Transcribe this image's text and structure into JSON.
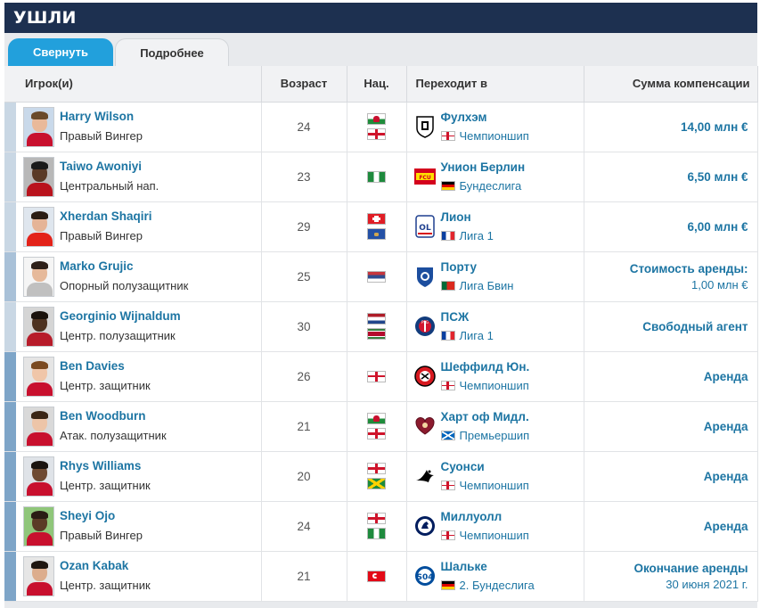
{
  "section_title": "УШЛИ",
  "tabs": {
    "collapse": "Свернуть",
    "details": "Подробнее"
  },
  "columns": {
    "player": "Игрок(и)",
    "age": "Возраст",
    "nationality": "Нац.",
    "to": "Переходит в",
    "fee": "Сумма компенсации"
  },
  "colors": {
    "header_bg": "#1d3050",
    "tab_active": "#22a0dc",
    "link": "#1d75a3"
  },
  "rows": [
    {
      "name": "Harry Wilson",
      "position": "Правый Вингер",
      "age": "24",
      "flags": [
        "wales-flag",
        "england-flag"
      ],
      "club": "Фулхэм",
      "club_icon": "fulham-crest",
      "league_flag": "england-flag",
      "league": "Чемпионшип",
      "fee": "14,00 млн €",
      "fee_note": ""
    },
    {
      "name": "Taiwo Awoniyi",
      "position": "Центральный нап.",
      "age": "23",
      "flags": [
        "nigeria-flag"
      ],
      "club": "Унион Берлин",
      "club_icon": "union-berlin-crest",
      "league_flag": "germany-flag",
      "league": "Бундеслига",
      "fee": "6,50 млн €",
      "fee_note": ""
    },
    {
      "name": "Xherdan Shaqiri",
      "position": "Правый Вингер",
      "age": "29",
      "flags": [
        "switzerland-flag",
        "kosovo-flag"
      ],
      "club": "Лион",
      "club_icon": "lyon-crest",
      "league_flag": "france-flag",
      "league": "Лига 1",
      "fee": "6,00 млн €",
      "fee_note": ""
    },
    {
      "name": "Marko Grujic",
      "position": "Опорный полузащитник",
      "age": "25",
      "flags": [
        "serbia-flag"
      ],
      "club": "Порту",
      "club_icon": "porto-crest",
      "league_flag": "portugal-flag",
      "league": "Лига Бвин",
      "fee": "Стоимость аренды:",
      "fee_note": "1,00 млн €"
    },
    {
      "name": "Georginio Wijnaldum",
      "position": "Центр. полузащитник",
      "age": "30",
      "flags": [
        "netherlands-flag",
        "suriname-flag"
      ],
      "club": "ПСЖ",
      "club_icon": "psg-crest",
      "league_flag": "france-flag",
      "league": "Лига 1",
      "fee": "Свободный агент",
      "fee_note": ""
    },
    {
      "name": "Ben Davies",
      "position": "Центр. защитник",
      "age": "26",
      "flags": [
        "england-flag"
      ],
      "club": "Шеффилд Юн.",
      "club_icon": "sheffield-united-crest",
      "league_flag": "england-flag",
      "league": "Чемпионшип",
      "fee": "Аренда",
      "fee_note": ""
    },
    {
      "name": "Ben Woodburn",
      "position": "Атак. полузащитник",
      "age": "21",
      "flags": [
        "wales-flag",
        "england-flag"
      ],
      "club": "Харт оф Мидл.",
      "club_icon": "hearts-crest",
      "league_flag": "scotland-flag",
      "league": "Премьершип",
      "fee": "Аренда",
      "fee_note": ""
    },
    {
      "name": "Rhys Williams",
      "position": "Центр. защитник",
      "age": "20",
      "flags": [
        "england-flag",
        "jamaica-flag"
      ],
      "club": "Суонси",
      "club_icon": "swansea-crest",
      "league_flag": "england-flag",
      "league": "Чемпионшип",
      "fee": "Аренда",
      "fee_note": ""
    },
    {
      "name": "Sheyi Ojo",
      "position": "Правый Вингер",
      "age": "24",
      "flags": [
        "england-flag",
        "nigeria-flag"
      ],
      "club": "Миллуолл",
      "club_icon": "millwall-crest",
      "league_flag": "england-flag",
      "league": "Чемпионшип",
      "fee": "Аренда",
      "fee_note": ""
    },
    {
      "name": "Ozan Kabak",
      "position": "Центр. защитник",
      "age": "21",
      "flags": [
        "turkey-flag"
      ],
      "club": "Шальке",
      "club_icon": "schalke-crest",
      "league_flag": "germany-flag",
      "league": "2. Бундеслига",
      "fee": "Окончание аренды",
      "fee_note": "30 июня 2021 г."
    }
  ]
}
